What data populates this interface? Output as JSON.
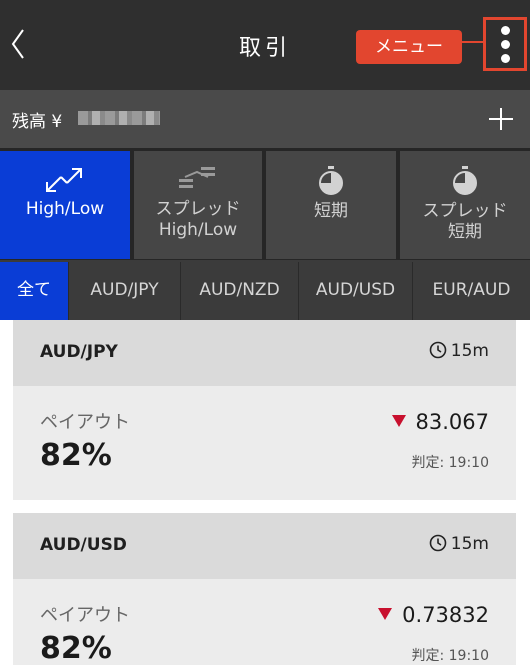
{
  "header": {
    "back_icon": "chevron-left-icon",
    "title": "取引",
    "menu_callout": "メニュー",
    "menu_icon": "more-vertical-icon"
  },
  "balance": {
    "label": "残高 ¥",
    "plus_icon": "plus-icon"
  },
  "trade_types": [
    {
      "label_1": "High/Low",
      "label_2": "",
      "icon": "high-low-arrows-icon",
      "active": true
    },
    {
      "label_1": "スプレッド",
      "label_2": "High/Low",
      "icon": "spread-bars-icon",
      "active": false
    },
    {
      "label_1": "短期",
      "label_2": "",
      "icon": "timer-icon",
      "active": false
    },
    {
      "label_1": "スプレッド",
      "label_2": "短期",
      "icon": "timer-icon",
      "active": false
    }
  ],
  "tabs": [
    "全て",
    "AUD/JPY",
    "AUD/NZD",
    "AUD/USD",
    "EUR/AUD"
  ],
  "cards": [
    {
      "pair": "AUD/JPY",
      "duration": "15m",
      "payout_label": "ペイアウト",
      "payout": "82%",
      "rate": "83.067",
      "direction": "down",
      "judge": "判定: 19:10"
    },
    {
      "pair": "AUD/USD",
      "duration": "15m",
      "payout_label": "ペイアウト",
      "payout": "82%",
      "rate": "0.73832",
      "direction": "down",
      "judge": "判定: 19:10"
    }
  ],
  "colors": {
    "accent": "#0a3dd6",
    "callout": "#e2462f",
    "down": "#c8102e"
  }
}
